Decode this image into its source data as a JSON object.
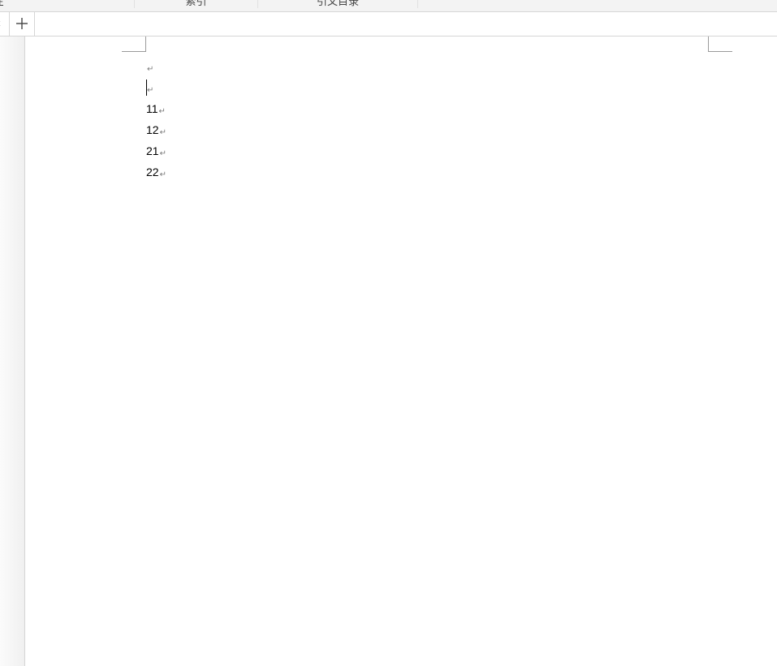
{
  "ribbon": {
    "groups": [
      "题注",
      "索引",
      "引文目录"
    ]
  },
  "tabbar": {
    "scroll_left_glyph": "‹",
    "new_tab_icon": "plus-icon"
  },
  "document": {
    "paragraph_mark": "↵",
    "paragraphs": [
      "",
      "",
      "11",
      "12",
      "21",
      "22"
    ]
  }
}
